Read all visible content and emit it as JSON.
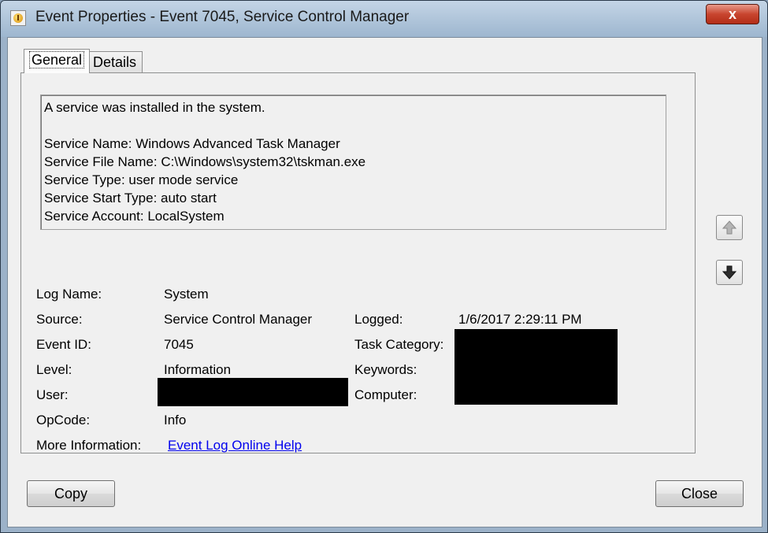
{
  "window": {
    "title": "Event Properties - Event 7045, Service Control Manager",
    "close_glyph": "x"
  },
  "tabs": [
    {
      "label": "General"
    },
    {
      "label": "Details"
    }
  ],
  "description": {
    "lines": [
      "A service was installed in the system.",
      "Service Name:  Windows Advanced Task Manager",
      "Service File Name:  C:\\Windows\\system32\\tskman.exe",
      "Service Type:  user mode service",
      "Service Start Type:  auto start",
      "Service Account:  LocalSystem"
    ]
  },
  "fields": {
    "log_name": {
      "label": "Log Name:",
      "value": "System"
    },
    "source": {
      "label": "Source:",
      "value": "Service Control Manager"
    },
    "event_id": {
      "label": "Event ID:",
      "value": "7045"
    },
    "level": {
      "label": "Level:",
      "value": "Information"
    },
    "user": {
      "label": "User:",
      "value": ""
    },
    "opcode": {
      "label": "OpCode:",
      "value": "Info"
    },
    "more_info": {
      "label": "More Information:",
      "link": "Event Log Online Help"
    },
    "logged": {
      "label": "Logged:",
      "value": "1/6/2017 2:29:11 PM"
    },
    "task_category": {
      "label": "Task Category:",
      "value": ""
    },
    "keywords": {
      "label": "Keywords:",
      "value": ""
    },
    "computer": {
      "label": "Computer:",
      "value": ""
    }
  },
  "buttons": {
    "copy": "Copy",
    "close": "Close"
  },
  "nav": {
    "up_icon": "arrow-up-icon",
    "down_icon": "arrow-down-icon"
  },
  "colors": {
    "link": "#0000ee",
    "redaction": "#000000",
    "close_button": "#c8452f"
  }
}
